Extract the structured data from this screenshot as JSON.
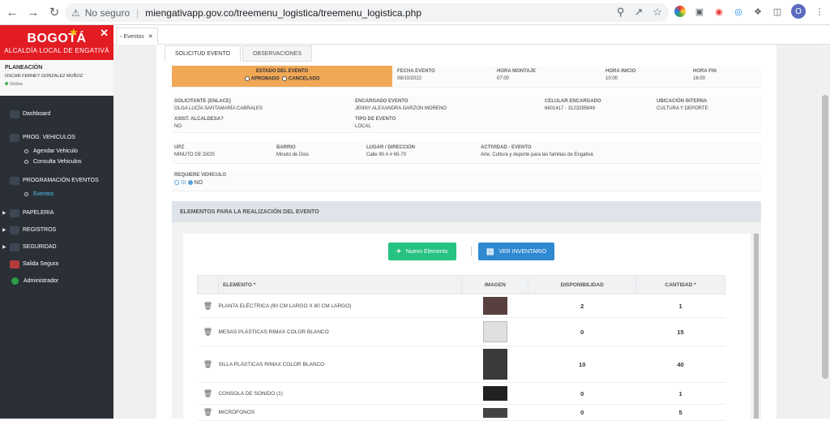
{
  "browser": {
    "insecure_label": "No seguro",
    "url": "miengativapp.gov.co/treemenu_logistica/treemenu_logistica.php",
    "profile_initial": "O"
  },
  "sidebar": {
    "brand_title": "BOGOTÁ",
    "brand_sub": "ALCALDÍA LOCAL DE ENGATIVÁ",
    "user_role": "PLANEACIÓN",
    "user_name": "OSCAR FERNEY GONZALEZ MUÑOZ",
    "user_status": "Online",
    "items": [
      {
        "label": "Dashboard"
      },
      {
        "label": "PROG. VEHICULOS"
      },
      {
        "label": "Agendar Vehiculo"
      },
      {
        "label": "Consulta Vehiculos"
      },
      {
        "label": "PROGRAMACIÓN EVENTOS"
      },
      {
        "label": "Eventos"
      },
      {
        "label": "PAPELERIA"
      },
      {
        "label": "REGISTROS"
      },
      {
        "label": "SEGURIDAD"
      },
      {
        "label": "Salida Segura"
      },
      {
        "label": "Administrador"
      }
    ]
  },
  "page_tab": {
    "label": "Eventos"
  },
  "form_tabs": [
    {
      "label": "SOLICITUD EVENTO"
    },
    {
      "label": "OBSERVACIONES"
    }
  ],
  "estado": {
    "label": "ESTADO DEL EVENTO",
    "opt1": "APROBADO",
    "opt2": "CANCELADO"
  },
  "fields": {
    "fecha_lbl": "FECHA EVENTO",
    "fecha_val": "08/10/2022",
    "montaje_lbl": "HORA MONTAJE",
    "montaje_val": "07:00",
    "inicio_lbl": "HORA INICIO",
    "inicio_val": "10:00",
    "fin_lbl": "HORA FIN",
    "fin_val": "16:00",
    "solicitante_lbl": "SOLICITANTE (ENLACE)",
    "solicitante_val": "OLGA LUCÍA SANTAMARÍA CABRALES",
    "encargado_lbl": "ENCARGADO EVENTO",
    "encargado_val": "JENNY ALEXANDRA GARZON MORENO",
    "celular_lbl": "CELULAR ENCARGADO",
    "celular_val": "6601417 - 3123295849",
    "ubicacion_lbl": "UBICACIÓN INTERNA",
    "ubicacion_val": "CULTURA Y DEPORTE",
    "asist_lbl": "ASIST. ALCALDESA?",
    "asist_val": "NO",
    "tipo_lbl": "TIPO DE EVENTO",
    "tipo_val": "LOCAL",
    "upz_lbl": "UPZ",
    "upz_val": "MINUTO DE DIOS",
    "barrio_lbl": "BARRIO",
    "barrio_val": "Minuto de Dios",
    "lugar_lbl": "LUGAR / DIRECCIÓN",
    "lugar_val": "Calle 90 A # 65-70",
    "actividad_lbl": "ACTIVIDAD - EVENTO",
    "actividad_val": "Arte, Cultura y deporte para las familias de Engativá",
    "vehiculo_lbl": "REQUIERE VEHÍCULO",
    "vehiculo_si": "SI",
    "vehiculo_no": "NO"
  },
  "section_title": "ELEMENTOS PARA LA REALIZACIÓN DEL EVENTO",
  "buttons": {
    "nuevo": "Nuevo Elemento",
    "inventario": "VER INVENTARIO"
  },
  "table": {
    "headers": [
      "ELEMENTO *",
      "IMAGEN",
      "DISPONIBILIDAD",
      "CANTIDAD *"
    ],
    "rows": [
      {
        "elemento": "PLANTA ELÉCTRICA (90 CM LARGO X 80 CM LARGO)",
        "disponibilidad": "2",
        "cantidad": "1"
      },
      {
        "elemento": "MESAS PLÁSTICAS RIMAX COLOR BLANCO",
        "disponibilidad": "0",
        "cantidad": "15"
      },
      {
        "elemento": "SILLA PLÁSTICAS RIMAX COLOR BLANCO",
        "disponibilidad": "10",
        "cantidad": "40"
      },
      {
        "elemento": "CONSOLA DE SONIDO (1)",
        "disponibilidad": "0",
        "cantidad": "1"
      },
      {
        "elemento": "MICRÓFONOS",
        "disponibilidad": "0",
        "cantidad": "5"
      }
    ]
  },
  "colors": {
    "brand_red": "#e31b23",
    "estado_orange": "#f0a857",
    "btn_green": "#26c281",
    "btn_blue": "#2f89d1"
  }
}
